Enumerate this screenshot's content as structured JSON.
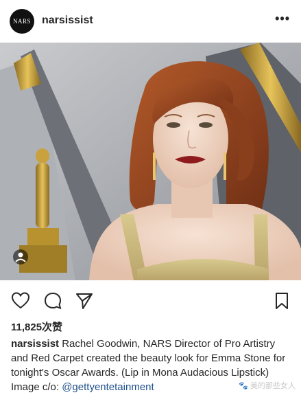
{
  "post": {
    "username": "narsissist",
    "avatar_text": "NARS",
    "more_icon": "•••",
    "likes": "11,825次赞",
    "caption_user": "narsissist",
    "caption_text": " Rachel Goodwin, NARS Director of Pro Artistry and Red Carpet created the beauty look for Emma Stone for tonight's Oscar Awards. (Lip in Mona Audacious Lipstick) Image c/o: ",
    "caption_link": "@gettyente​tainment"
  },
  "watermark": "🐾 美的那些女人",
  "icons": [
    "heart-icon",
    "comment-icon",
    "share-icon",
    "bookmark-icon",
    "more-icon"
  ],
  "colors": {
    "link": "#1d4f8a",
    "text": "#262626",
    "lip": "#8e1b1e",
    "hair": "#9a4a22"
  }
}
